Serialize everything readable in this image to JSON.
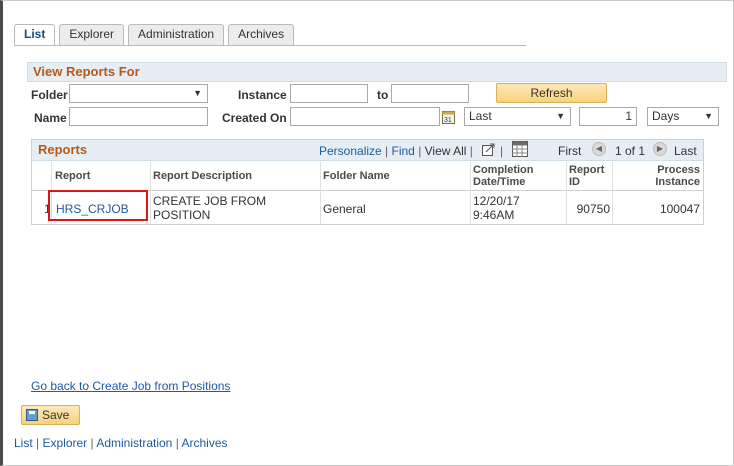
{
  "tabs": [
    "List",
    "Explorer",
    "Administration",
    "Archives"
  ],
  "view_reports": {
    "title": "View Reports For",
    "folder_label": "Folder",
    "folder_value": "",
    "instance_label": "Instance",
    "instance_from": "",
    "to_label": "to",
    "instance_to": "",
    "refresh_label": "Refresh",
    "name_label": "Name",
    "name_value": "",
    "created_on_label": "Created On",
    "created_on_value": "",
    "last_select": "Last",
    "count_value": "1",
    "unit_select": "Days"
  },
  "reports": {
    "title": "Reports",
    "personalize": "Personalize",
    "find": "Find",
    "view_all": "View All",
    "first": "First",
    "page_info": "1 of 1",
    "last": "Last",
    "columns": [
      "Report",
      "Report Description",
      "Folder Name",
      "Completion Date/Time",
      "Report ID",
      "Process Instance"
    ],
    "columns_split": {
      "completion_1": "Completion",
      "completion_2": "Date/Time",
      "report_id_1": "Report",
      "report_id_2": "ID",
      "process_1": "Process",
      "process_2": "Instance"
    },
    "rows": [
      {
        "num": "1",
        "report": "HRS_CRJOB",
        "desc_1": "CREATE JOB FROM",
        "desc_2": "POSITION",
        "folder": "General",
        "date_1": "12/20/17",
        "date_2": "9:46AM",
        "report_id": "90750",
        "process_instance": "100047"
      }
    ]
  },
  "go_back": "Go back to Create Job from Positions",
  "save_label": "Save",
  "footer": [
    "List",
    "Explorer",
    "Administration",
    "Archives"
  ],
  "icons": [
    "calendar-icon",
    "download-icon",
    "grid-icon",
    "prev-icon",
    "next-icon",
    "save-icon"
  ]
}
